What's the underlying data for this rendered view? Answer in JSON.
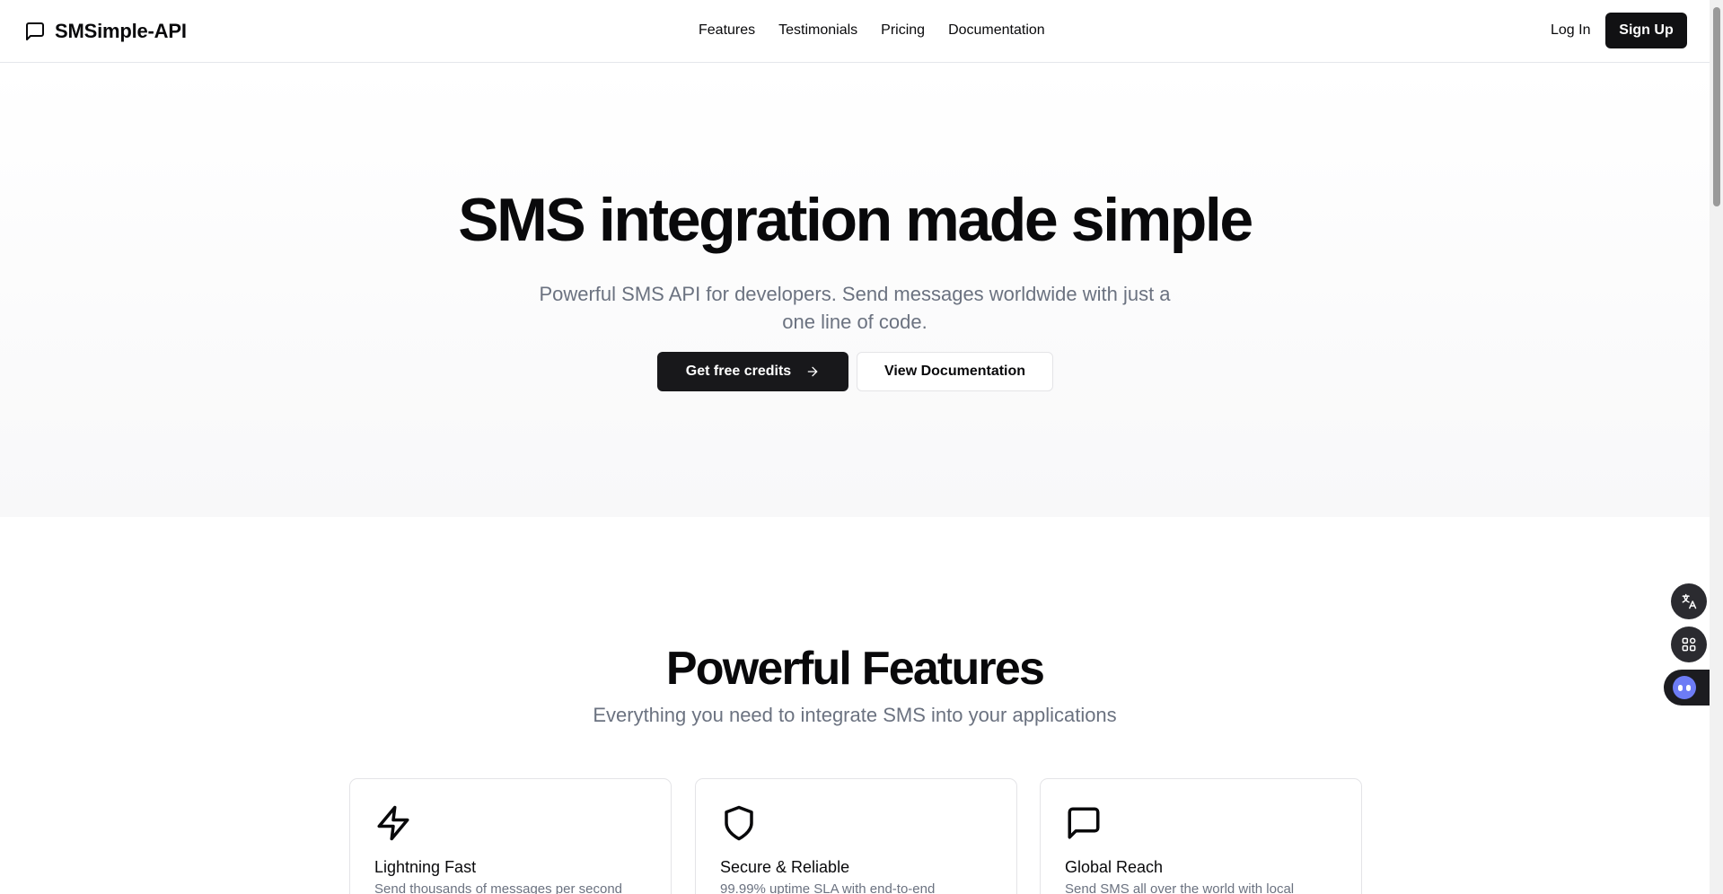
{
  "header": {
    "brand": "SMSimple-API",
    "nav": [
      "Features",
      "Testimonials",
      "Pricing",
      "Documentation"
    ],
    "login": "Log In",
    "signup": "Sign Up"
  },
  "hero": {
    "title": "SMS integration made simple",
    "subtitle": "Powerful SMS API for developers. Send messages worldwide with just a one line of code.",
    "primary_button": "Get free credits",
    "secondary_button": "View Documentation"
  },
  "features": {
    "title": "Powerful Features",
    "subtitle": "Everything you need to integrate SMS into your applications",
    "cards": [
      {
        "icon": "lightning-icon",
        "title": "Lightning Fast",
        "desc": "Send thousands of messages per second"
      },
      {
        "icon": "shield-icon",
        "title": "Secure & Reliable",
        "desc": "99.99% uptime SLA with end-to-end"
      },
      {
        "icon": "message-square-icon",
        "title": "Global Reach",
        "desc": "Send SMS all over the world with local"
      }
    ]
  },
  "widgets": [
    "translate-icon",
    "apps-grid-icon",
    "assistant-icon"
  ],
  "colors": {
    "primary": "#18181b",
    "muted_text": "#6b7280",
    "border": "#e4e4e7",
    "assistant": "#6d7cf5"
  }
}
